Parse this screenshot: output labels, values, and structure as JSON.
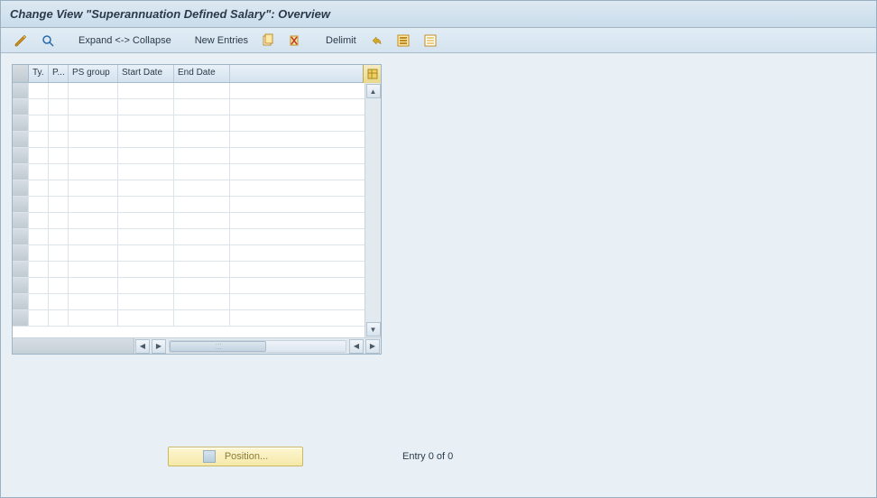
{
  "header": {
    "title": "Change View \"Superannuation Defined Salary\": Overview"
  },
  "toolbar": {
    "expand_collapse": "Expand <-> Collapse",
    "new_entries": "New Entries",
    "delimit": "Delimit"
  },
  "grid": {
    "columns": [
      "Ty.",
      "P...",
      "PS group",
      "Start Date",
      "End Date"
    ],
    "rows": []
  },
  "footer": {
    "position_button": "Position...",
    "entry_text": "Entry 0 of 0"
  }
}
